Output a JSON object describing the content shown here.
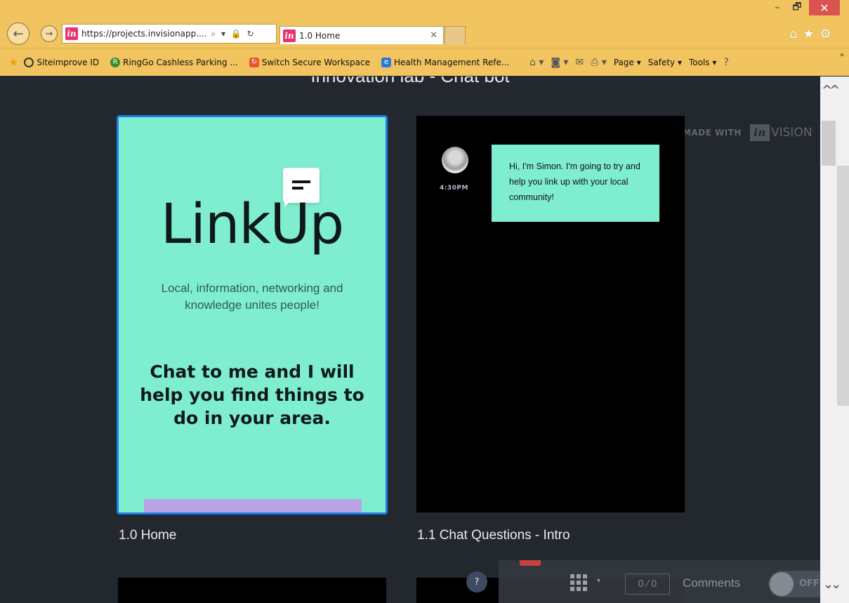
{
  "browser": {
    "window_controls": {
      "minimize": "–",
      "restore": "🗗",
      "close": "✕"
    },
    "address_url": "https://projects.invisionapp....",
    "address_tools": "⌕ ▾ 🔒 ↻",
    "tab_title": "1.0 Home",
    "tab_close": "✕",
    "right_icons": [
      "home-icon",
      "star-icon",
      "gear-icon"
    ],
    "favorites": [
      {
        "label": "Siteimprove ID",
        "icon": "siteimprove-icon"
      },
      {
        "label": "RingGo Cashless Parking ...",
        "icon": "ringgo-icon"
      },
      {
        "label": "Switch Secure Workspace",
        "icon": "switch-icon"
      },
      {
        "label": "Health Management Refe...",
        "icon": "ie-icon"
      }
    ],
    "command_bar": {
      "page": "Page ▾",
      "safety": "Safety ▾",
      "tools": "Tools ▾",
      "help": "?",
      "overflow": "»"
    }
  },
  "project": {
    "title": "Innovation lab - Chat bot",
    "made_with_label": "MADE WITH",
    "made_with_logo": "in",
    "made_with_brand": "VISION"
  },
  "screens": [
    {
      "caption": "1.0 Home",
      "logo": "LinkUp",
      "tagline": "Local, information, networking and knowledge unites people!",
      "cta": "Chat to me and I will help you find things to do in your area."
    },
    {
      "caption": "1.1 Chat Questions - Intro",
      "time": "4:30PM",
      "message": "Hi, I'm Simon. I'm going to try and help you link up with your local community!"
    }
  ],
  "toolbar": {
    "help": "?",
    "counter": "0 ⁄ 0",
    "comments_label": "Comments",
    "toggle_state": "OFF"
  },
  "colors": {
    "accent_mint": "#7feed0",
    "selection_blue": "#1e7bea",
    "chrome_yellow": "#f2c45f",
    "invision_pink": "#e8336b"
  }
}
